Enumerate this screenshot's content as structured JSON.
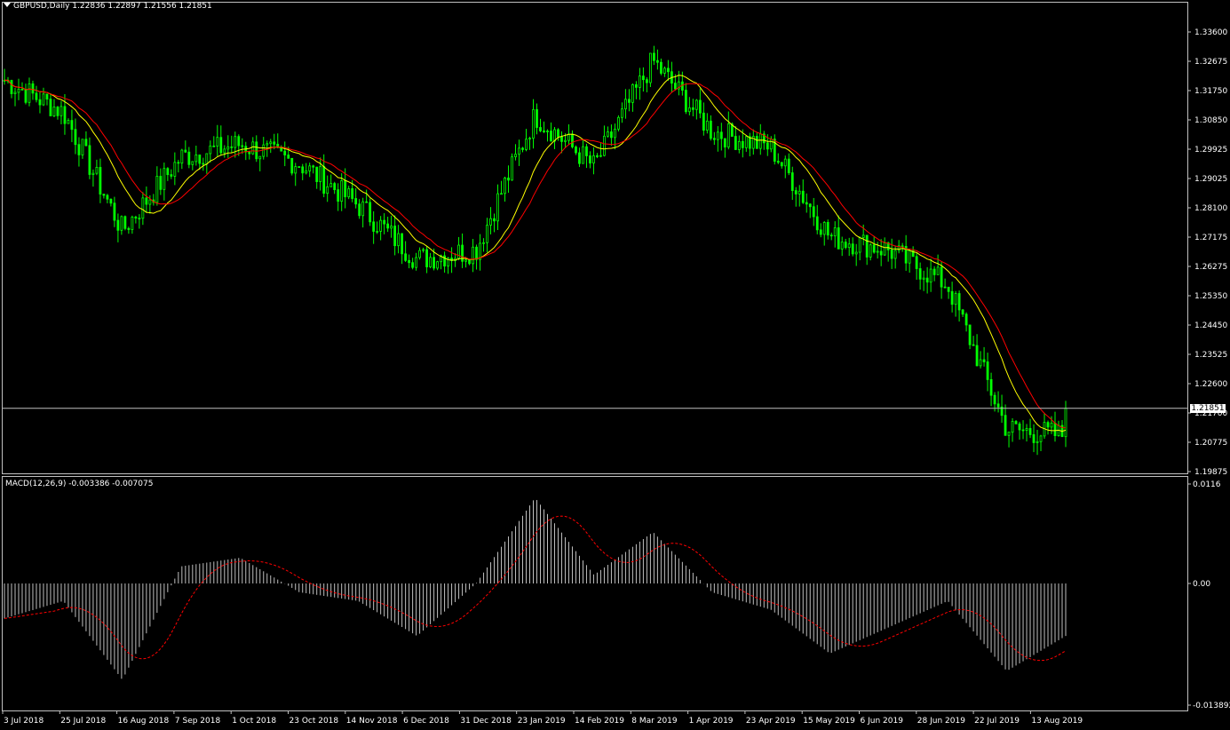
{
  "main_chart": {
    "symbol": "GBPUSD",
    "timeframe": "Daily",
    "header_text": "GBPUSD,Daily  1.22836 1.22897 1.21556 1.21851",
    "ohlc": {
      "open": "1.22836",
      "high": "1.22897",
      "low": "1.21556",
      "close": "1.21851"
    },
    "current_price_label": "1.21851",
    "price_ticks": [
      "1.33600",
      "1.32675",
      "1.31750",
      "1.30850",
      "1.29925",
      "1.29025",
      "1.28100",
      "1.27175",
      "1.26275",
      "1.25350",
      "1.24450",
      "1.23525",
      "1.22600",
      "1.21700",
      "1.20775",
      "1.19875"
    ],
    "colors": {
      "background": "#000000",
      "candles": "#00ff00",
      "ma_fast": "#ffff00",
      "ma_slow": "#ff0000",
      "grid_line": "#c0c0c0"
    }
  },
  "macd": {
    "header_text": "MACD(12,26,9) -0.003386 -0.007075",
    "params": "12,26,9",
    "macd_value": "-0.003386",
    "signal_value": "-0.007075",
    "scale_ticks": [
      "0.0116",
      "0.00",
      "-0.013892"
    ],
    "colors": {
      "histogram": "#c0c0c0",
      "signal": "#ff0000"
    }
  },
  "date_labels": [
    "3 Jul 2018",
    "25 Jul 2018",
    "16 Aug 2018",
    "7 Sep 2018",
    "1 Oct 2018",
    "23 Oct 2018",
    "14 Nov 2018",
    "6 Dec 2018",
    "31 Dec 2018",
    "23 Jan 2019",
    "14 Feb 2019",
    "8 Mar 2019",
    "1 Apr 2019",
    "23 Apr 2019",
    "15 May 2019",
    "6 Jun 2019",
    "28 Jun 2019",
    "22 Jul 2019",
    "13 Aug 2019"
  ],
  "chart_data": {
    "type": "line",
    "title": "GBPUSD,Daily",
    "x": [
      "3 Jul 2018",
      "25 Jul 2018",
      "16 Aug 2018",
      "7 Sep 2018",
      "1 Oct 2018",
      "23 Oct 2018",
      "14 Nov 2018",
      "6 Dec 2018",
      "31 Dec 2018",
      "23 Jan 2019",
      "14 Feb 2019",
      "8 Mar 2019",
      "1 Apr 2019",
      "23 Apr 2019",
      "15 May 2019",
      "6 Jun 2019",
      "28 Jun 2019",
      "22 Jul 2019",
      "13 Aug 2019"
    ],
    "series": [
      {
        "values": [
          1.321,
          1.311,
          1.274,
          1.297,
          1.301,
          1.295,
          1.282,
          1.265,
          1.268,
          1.31,
          1.294,
          1.327,
          1.305,
          1.3,
          1.272,
          1.268,
          1.257,
          1.212,
          1.21
        ]
      }
    ],
    "macd_series": [
      {
        "values": [
          -0.004,
          -0.002,
          -0.011,
          0.002,
          0.003,
          -0.001,
          -0.002,
          -0.006,
          0.0,
          0.01,
          0.001,
          0.006,
          -0.001,
          -0.003,
          -0.008,
          -0.005,
          -0.002,
          -0.01,
          -0.006
        ]
      }
    ],
    "ylim": [
      1.195,
      1.339
    ],
    "macd_ylim": [
      -0.013892,
      0.0116
    ],
    "last_close": 1.21851
  }
}
